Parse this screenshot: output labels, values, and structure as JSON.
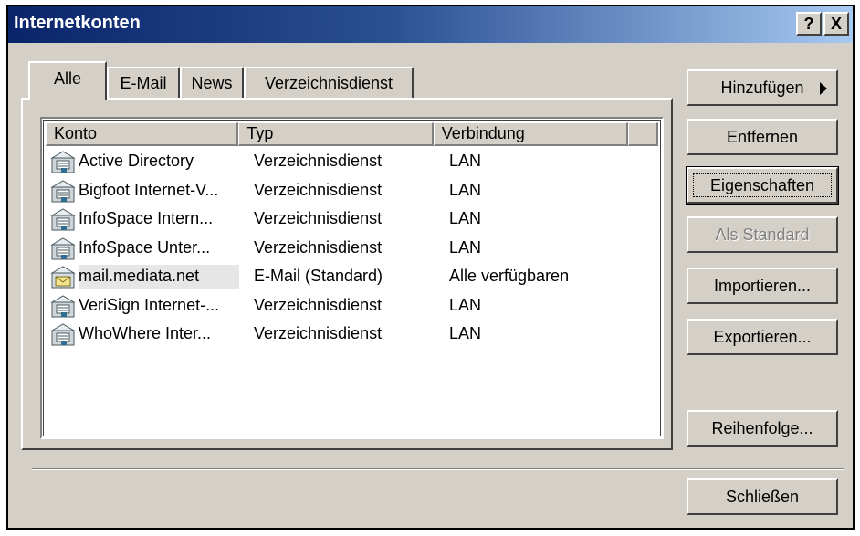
{
  "window": {
    "title": "Internetkonten",
    "help_label": "?",
    "close_label": "X"
  },
  "tabs": [
    {
      "label": "Alle",
      "active": true
    },
    {
      "label": "E-Mail",
      "active": false
    },
    {
      "label": "News",
      "active": false
    },
    {
      "label": "Verzeichnisdienst",
      "active": false
    }
  ],
  "list": {
    "columns": [
      "Konto",
      "Typ",
      "Verbindung"
    ],
    "rows": [
      {
        "konto": "Active Directory",
        "typ": "Verzeichnisdienst",
        "verbindung": "LAN",
        "icon": "directory-service-icon"
      },
      {
        "konto": "Bigfoot Internet-V...",
        "typ": "Verzeichnisdienst",
        "verbindung": "LAN",
        "icon": "directory-service-icon"
      },
      {
        "konto": "InfoSpace Intern...",
        "typ": "Verzeichnisdienst",
        "verbindung": "LAN",
        "icon": "directory-service-icon"
      },
      {
        "konto": "InfoSpace Unter...",
        "typ": "Verzeichnisdienst",
        "verbindung": "LAN",
        "icon": "directory-service-icon"
      },
      {
        "konto": "mail.mediata.net",
        "typ": "E-Mail (Standard)",
        "verbindung": "Alle verfügbaren",
        "icon": "mail-account-icon",
        "selected": true
      },
      {
        "konto": "VeriSign Internet-...",
        "typ": "Verzeichnisdienst",
        "verbindung": "LAN",
        "icon": "directory-service-icon"
      },
      {
        "konto": "WhoWhere Inter...",
        "typ": "Verzeichnisdienst",
        "verbindung": "LAN",
        "icon": "directory-service-icon"
      }
    ]
  },
  "buttons": {
    "add": "Hinzufügen",
    "remove": "Entfernen",
    "properties": "Eigenschaften",
    "set_default": "Als Standard",
    "import": "Importieren...",
    "export": "Exportieren...",
    "order": "Reihenfolge...",
    "close": "Schließen"
  },
  "colors": {
    "titlebar_start": "#0a246a",
    "titlebar_end": "#a6caf0",
    "face": "#d4d0c8"
  }
}
